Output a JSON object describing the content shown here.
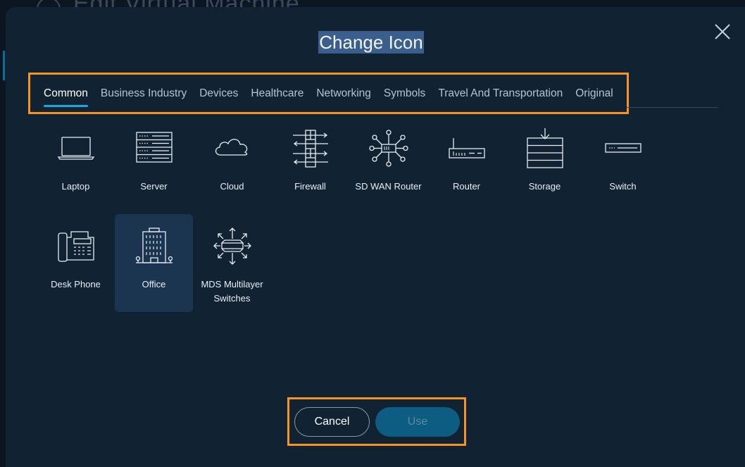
{
  "backdrop": {
    "title": "Edit Virtual Machine"
  },
  "dialog": {
    "title": "Change Icon",
    "close_icon": "close-icon"
  },
  "tabs": [
    {
      "label": "Common",
      "active": true
    },
    {
      "label": "Business Industry",
      "active": false
    },
    {
      "label": "Devices",
      "active": false
    },
    {
      "label": "Healthcare",
      "active": false
    },
    {
      "label": "Networking",
      "active": false
    },
    {
      "label": "Symbols",
      "active": false
    },
    {
      "label": "Travel And Transportation",
      "active": false
    },
    {
      "label": "Original",
      "active": false
    }
  ],
  "icons": [
    {
      "label": "Laptop",
      "icon": "laptop-icon",
      "selected": false
    },
    {
      "label": "Server",
      "icon": "server-icon",
      "selected": false
    },
    {
      "label": "Cloud",
      "icon": "cloud-icon",
      "selected": false
    },
    {
      "label": "Firewall",
      "icon": "firewall-icon",
      "selected": false
    },
    {
      "label": "SD WAN Router",
      "icon": "sd-wan-router-icon",
      "selected": false
    },
    {
      "label": "Router",
      "icon": "router-icon",
      "selected": false
    },
    {
      "label": "Storage",
      "icon": "storage-icon",
      "selected": false
    },
    {
      "label": "Switch",
      "icon": "switch-icon",
      "selected": false
    },
    {
      "label": "Desk Phone",
      "icon": "desk-phone-icon",
      "selected": false
    },
    {
      "label": "Office",
      "icon": "office-icon",
      "selected": true
    },
    {
      "label": "MDS Multilayer Switches",
      "icon": "mds-multilayer-switches-icon",
      "selected": false
    }
  ],
  "footer": {
    "cancel_label": "Cancel",
    "use_label": "Use",
    "use_enabled": false
  },
  "colors": {
    "highlight_outline": "#f7941d",
    "active_tab_underline": "#1ba7e0",
    "selected_card": "#1b3450",
    "primary_button": "#0d5c82",
    "dialog_background": "#112233"
  }
}
